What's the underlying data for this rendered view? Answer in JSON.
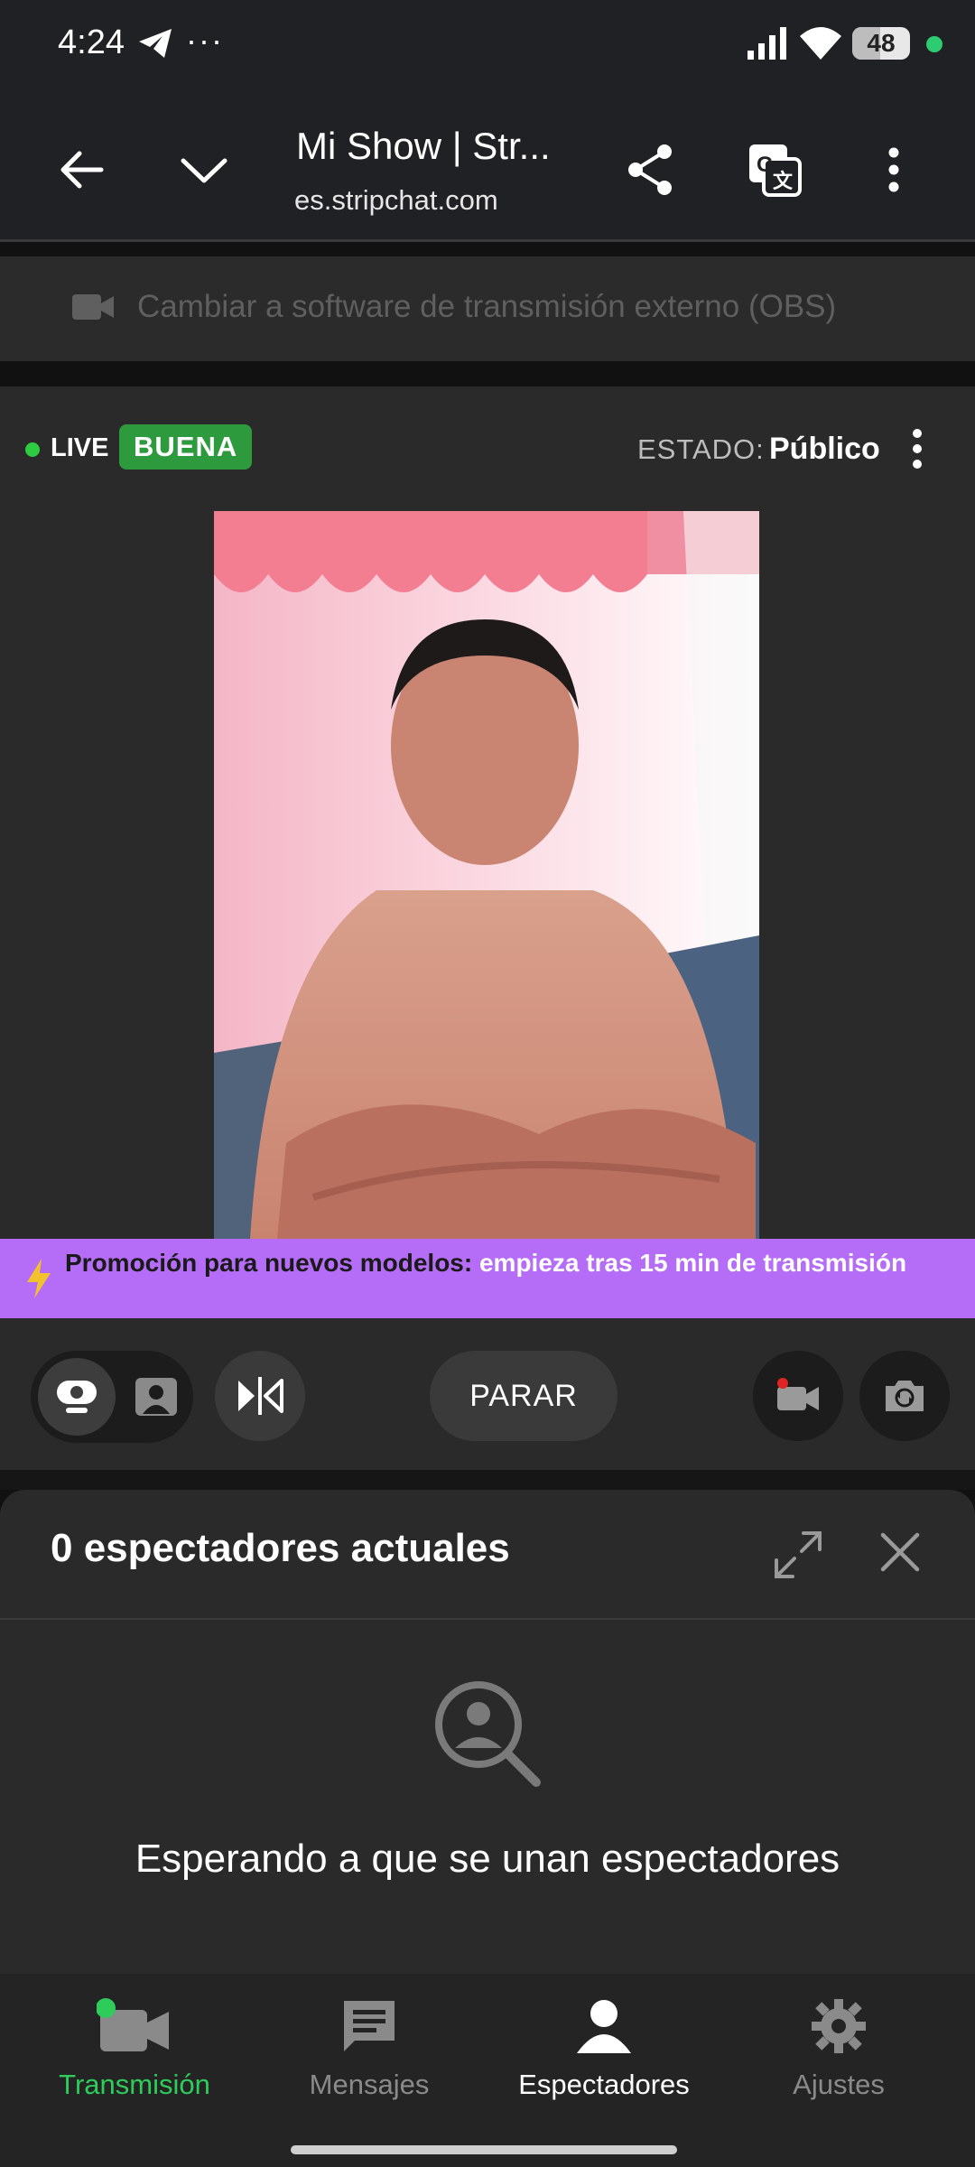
{
  "status_bar": {
    "time": "4:24",
    "overflow_dots": "···",
    "battery": "48",
    "indicator_color": "#2ecc71"
  },
  "browser": {
    "title": "Mi Show | Str...",
    "url": "es.stripchat.com",
    "icons": [
      "back-arrow-icon",
      "chevron-down-icon",
      "share-icon",
      "translate-icon",
      "more-vert-icon"
    ]
  },
  "obs_bar": {
    "text": "Cambiar a software de transmisión externo (OBS)"
  },
  "live_bar": {
    "live_label": "LIVE",
    "quality_badge": "BUENA",
    "estado_label": "ESTADO:",
    "estado_value": "Público"
  },
  "promo": {
    "lead": "Promoción para nuevos modelos:",
    "highlight": " empieza tras 15 min de transmisión"
  },
  "controls": {
    "stop_label": "PARAR",
    "icons": [
      "webcam-icon",
      "portrait-icon",
      "mirror-icon",
      "record-camera-icon",
      "flip-camera-icon"
    ]
  },
  "viewers_panel": {
    "heading": "0 espectadores actuales",
    "empty_message": "Esperando a que se unan espectadores"
  },
  "bottom_nav": {
    "items": [
      {
        "label": "Transmisión",
        "icon": "video-camera-icon",
        "state": "active"
      },
      {
        "label": "Mensajes",
        "icon": "message-icon",
        "state": "inactive"
      },
      {
        "label": "Espectadores",
        "icon": "person-icon",
        "state": "selected"
      },
      {
        "label": "Ajustes",
        "icon": "gear-icon",
        "state": "inactive"
      }
    ]
  },
  "colors": {
    "live_green": "#2ecc40",
    "badge_green": "#2e9a3e",
    "promo_purple": "#b56cf6",
    "active_green": "#2ecc5a"
  }
}
